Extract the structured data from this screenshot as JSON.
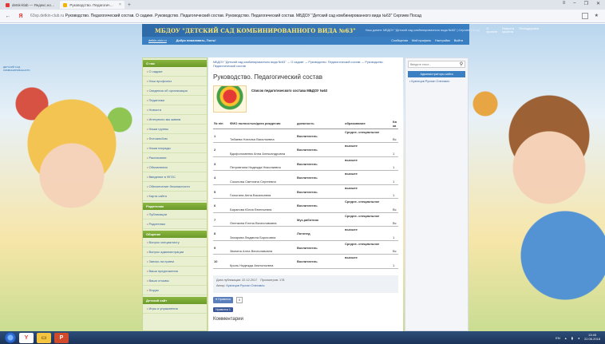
{
  "browser": {
    "tabs": [
      {
        "label": "detsk-klab — Яндекс.но…",
        "active": false
      },
      {
        "label": "Руководство. Педагогич…",
        "active": true
      }
    ],
    "new_tab": "+",
    "address": {
      "domain": "63sp.detkin-club.ru",
      "rest": "Руководство. Педагогический состав. О садике. Руководство. Педагогический состав. Руководство. Педагогический состав. МБДОУ \"Детский сад комбинированного вида №63\" Сергиев Посад"
    },
    "back": "←",
    "reload": "Я",
    "star": "★",
    "win_controls": [
      "≡",
      "–",
      "❐",
      "✕"
    ]
  },
  "site": {
    "title": "МБДОУ \"ДЕТСКИЙ САД КОМБИНИРОВАННОГО ВИДА №63\"",
    "title_links": "Наш домен: МБДОУ \"Детский сад комбинированного вида №63\" | Сергиев Посад",
    "top_links": [
      "О проекте",
      "Новости проекта",
      "Техподдержка"
    ],
    "sub_left": [
      "detkin-club.ru",
      "Добро пожаловать, Гость!"
    ],
    "sub_right": [
      "Сообщения",
      "Мой профиль",
      "Настройки",
      "Выйти"
    ],
    "brand": "ДЕТСКИЙ САД КОМБИНИРОВАННОГО"
  },
  "sidebar": {
    "blocks": [
      {
        "header": "О нас",
        "items": [
          "О садике",
          "Наш профсоюз",
          "Сведения об организации",
          "Педагогам",
          "Новости",
          "Интересно мы живем",
          "Наши группы",
          "Фотоальбом",
          "Наши награды",
          "Расписание",
          "Объявления",
          "Введение в ФГОС",
          "Обеспечение безопасности",
          "Карта сайта"
        ]
      },
      {
        "header": "Родителям",
        "items": [
          "Публикации",
          "Родителям"
        ]
      },
      {
        "header": "Общение",
        "items": [
          "Вопрос специалисту",
          "Вопрос администрации",
          "Запись на прием",
          "Ваши предложения",
          "Ваши отзывы",
          "Форум"
        ]
      },
      {
        "header": "Детский сайт",
        "items": [
          "Игры и упражнения"
        ]
      }
    ]
  },
  "main": {
    "breadcrumb": "МБДОУ \"Детский сад комбинированного вида №63\" → О садике → Руководство. Педагогический состав → Руководство. Педагогический состав",
    "heading": "Руководство. Педагогический состав",
    "doc_title": "Список педагогического состава МБДОУ №63",
    "table": {
      "headers": [
        "№ п/п",
        "ФИО полностью/дата рождения",
        "должность",
        "образование",
        "Кв ка"
      ],
      "rows": [
        {
          "n": "1",
          "name": "Табаева Наталья Васильевна",
          "pos": "Воспитатель",
          "edu": "Средне- специальное",
          "q": "Вс"
        },
        {
          "n": "2",
          "name": "Вдофоломеева Анна Александровна",
          "pos": "Воспитатель",
          "edu": "высшее",
          "q": "1"
        },
        {
          "n": "3",
          "name": "Петровнина Надежда Николаевна",
          "pos": "Воспитатель",
          "edu": "высшее",
          "q": "1"
        },
        {
          "n": "4",
          "name": "Соколова Светлана Сергеевна",
          "pos": "Воспитатель",
          "edu": "высшее",
          "q": "1"
        },
        {
          "n": "5",
          "name": "Голыгина Анна Васильевна",
          "pos": "Воспитатель",
          "edu": "высшее",
          "q": "1"
        },
        {
          "n": "6",
          "name": "Баранова Юлия Евгеньевна",
          "pos": "Воспитатель",
          "edu": "Средне- специальное",
          "q": "Вс"
        },
        {
          "n": "7",
          "name": "Опенкина Елена Вячеславовна",
          "pos": "Муз.работник",
          "edu": "Средне- специальное",
          "q": "Вс"
        },
        {
          "n": "8",
          "name": "Захарова Людмила Борисовна",
          "pos": "Логопед",
          "edu": "высшее",
          "q": "1"
        },
        {
          "n": "9",
          "name": "Звягина Алла Вячеславовна",
          "pos": "Воспитатель",
          "edu": "Средне- специальное",
          "q": "Вс"
        },
        {
          "n": "10",
          "name": "Кроль Надежда Анатольевна",
          "pos": "Воспитатель",
          "edu": "высшее",
          "q": "1"
        }
      ]
    },
    "meta": {
      "date_label": "Дата публикации: 22.12.2017",
      "views_label": "Просмотров: 178",
      "author_label": "Автор:",
      "author": "Кузнецов Руслан Олегович"
    },
    "share": {
      "like": "♥ Нравится",
      "count": "0",
      "fb": "Нравится 1"
    },
    "comments": "Комментарии"
  },
  "right": {
    "search_placeholder": "Введите текст...",
    "admin_header": "Администраторы сайта",
    "admin_items": [
      "Кузнецов Руслан Олегович"
    ]
  },
  "taskbar": {
    "lang": "EN",
    "time": "13:45",
    "date": "22.06.2018"
  }
}
